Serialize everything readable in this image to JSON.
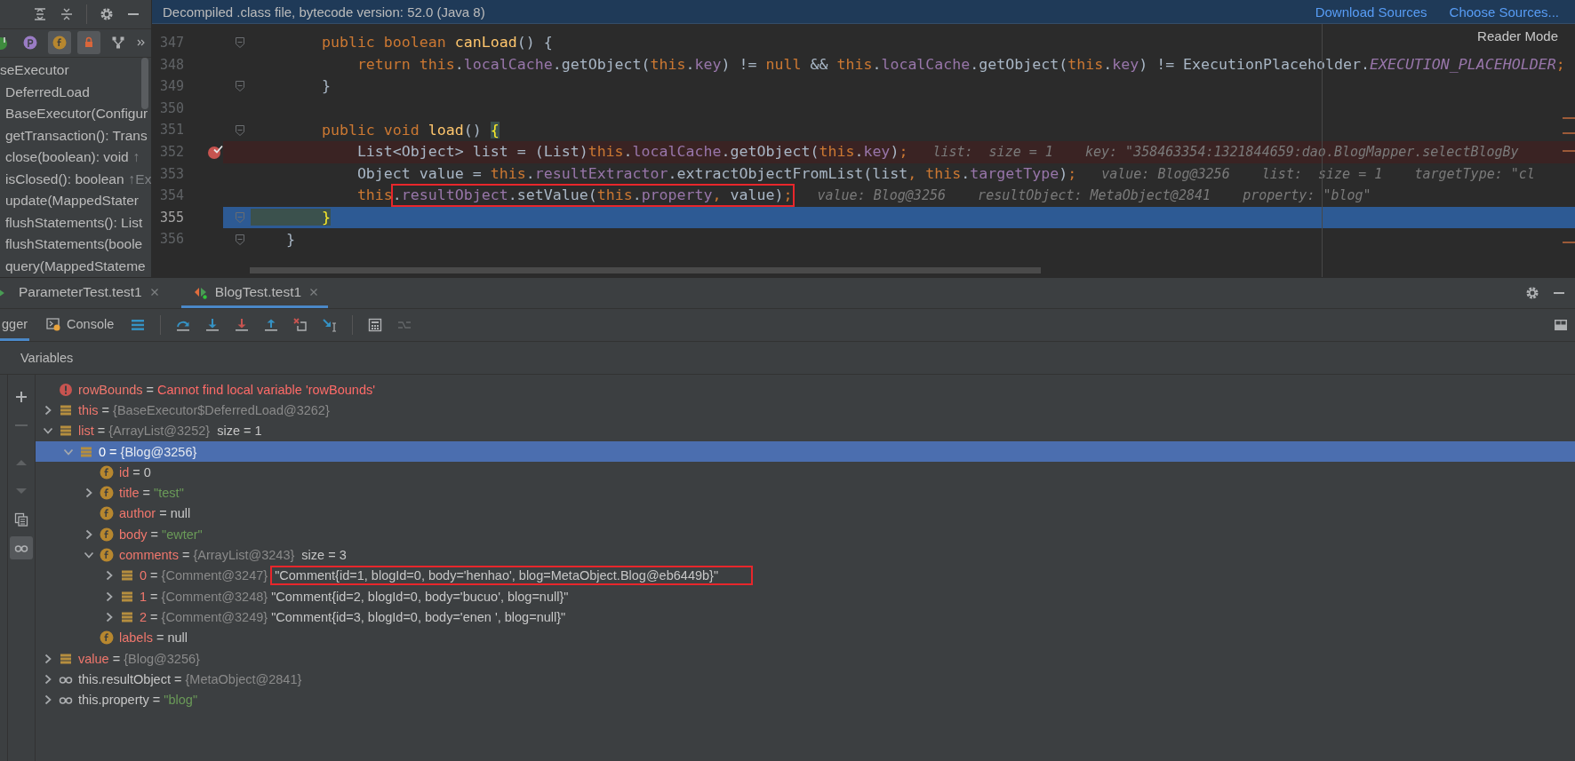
{
  "structure_panel": {
    "filters": [
      {
        "kind": "class",
        "on": false
      },
      {
        "kind": "property",
        "on": false
      },
      {
        "kind": "field",
        "on": true
      },
      {
        "kind": "lock",
        "on": true
      },
      {
        "kind": "inheritance",
        "on": false
      }
    ],
    "items": [
      {
        "text": "seExecutor",
        "children": [
          {
            "text": "DeferredLoad"
          },
          {
            "text": "BaseExecutor(Configur"
          },
          {
            "text": "getTransaction(): Trans"
          },
          {
            "text": "close(boolean): void",
            "suffix": "↑"
          },
          {
            "text": "isClosed(): boolean",
            "suffix": "↑Ex"
          },
          {
            "text": "update(MappedStater"
          },
          {
            "text": "flushStatements(): List"
          },
          {
            "text": "flushStatements(boole"
          },
          {
            "text": "query(MappedStateme"
          }
        ]
      }
    ]
  },
  "editor": {
    "banner": {
      "text": "Decompiled .class file, bytecode version: 52.0 (Java 8)",
      "links": [
        "Download Sources",
        "Choose Sources..."
      ]
    },
    "reader_mode": "Reader Mode",
    "lines": [
      {
        "number": "347",
        "kind": "normal",
        "fold": true,
        "tokens": [
          {
            "kind": "kw",
            "text": "        public boolean "
          },
          {
            "kind": "decl",
            "text": "canLoad"
          },
          {
            "kind": "plain",
            "text": "() {"
          }
        ]
      },
      {
        "number": "348",
        "kind": "normal",
        "fold": false,
        "tokens": [
          {
            "kind": "kw",
            "text": "            return this"
          },
          {
            "kind": "plain",
            "text": "."
          },
          {
            "kind": "fld",
            "text": "localCache"
          },
          {
            "kind": "plain",
            "text": ".getObject("
          },
          {
            "kind": "kw",
            "text": "this"
          },
          {
            "kind": "plain",
            "text": "."
          },
          {
            "kind": "fld",
            "text": "key"
          },
          {
            "kind": "plain",
            "text": ") != "
          },
          {
            "kind": "kw",
            "text": "null"
          },
          {
            "kind": "plain",
            "text": " && "
          },
          {
            "kind": "kw",
            "text": "this"
          },
          {
            "kind": "plain",
            "text": "."
          },
          {
            "kind": "fld",
            "text": "localCache"
          },
          {
            "kind": "plain",
            "text": ".getObject("
          },
          {
            "kind": "kw",
            "text": "this"
          },
          {
            "kind": "plain",
            "text": "."
          },
          {
            "kind": "fld",
            "text": "key"
          },
          {
            "kind": "plain",
            "text": ") != ExecutionPlaceholder."
          },
          {
            "kind": "const",
            "text": "EXECUTION_PLACEHOLDER"
          },
          {
            "kind": "kw",
            "text": ";"
          }
        ]
      },
      {
        "number": "349",
        "kind": "normal",
        "fold": true,
        "tokens": [
          {
            "kind": "plain",
            "text": "        }"
          }
        ]
      },
      {
        "number": "350",
        "kind": "normal",
        "fold": false
      },
      {
        "number": "351",
        "kind": "normal",
        "fold": true,
        "tokens": [
          {
            "kind": "kw",
            "text": "        public void "
          },
          {
            "kind": "decl",
            "text": "load"
          },
          {
            "kind": "plain",
            "text": "() "
          },
          {
            "kind": "brace",
            "text": "{"
          }
        ]
      },
      {
        "number": "352",
        "kind": "breakpoint",
        "fold": false,
        "tokens": [
          {
            "kind": "plain",
            "text": "            List<Object> list = (List)"
          },
          {
            "kind": "kw",
            "text": "this"
          },
          {
            "kind": "plain",
            "text": "."
          },
          {
            "kind": "fld",
            "text": "localCache"
          },
          {
            "kind": "plain",
            "text": ".getObject("
          },
          {
            "kind": "kw",
            "text": "this"
          },
          {
            "kind": "plain",
            "text": "."
          },
          {
            "kind": "fld",
            "text": "key"
          },
          {
            "kind": "plain",
            "text": ")"
          },
          {
            "kind": "kw",
            "text": ";"
          }
        ],
        "hints": "list:  size = 1    key: \"358463354:1321844659:dao.BlogMapper.selectBlogBy"
      },
      {
        "number": "353",
        "kind": "normal",
        "fold": false,
        "tokens": [
          {
            "kind": "plain",
            "text": "            Object value = "
          },
          {
            "kind": "kw",
            "text": "this"
          },
          {
            "kind": "plain",
            "text": "."
          },
          {
            "kind": "fld",
            "text": "resultExtractor"
          },
          {
            "kind": "plain",
            "text": ".extractObjectFromList(list"
          },
          {
            "kind": "kw",
            "text": ", this"
          },
          {
            "kind": "plain",
            "text": "."
          },
          {
            "kind": "fld",
            "text": "targetType"
          },
          {
            "kind": "plain",
            "text": ")"
          },
          {
            "kind": "kw",
            "text": ";"
          }
        ],
        "hints": "value: Blog@3256    list:  size = 1    targetType: \"cl"
      },
      {
        "number": "354",
        "kind": "normal",
        "fold": false,
        "tokens": [
          {
            "kind": "kw",
            "text": "            this"
          }
        ],
        "framed": [
          {
            "kind": "plain",
            "text": "."
          },
          {
            "kind": "fld",
            "text": "resultObject"
          },
          {
            "kind": "plain",
            "text": ".setValue("
          },
          {
            "kind": "kw",
            "text": "this"
          },
          {
            "kind": "plain",
            "text": "."
          },
          {
            "kind": "fld",
            "text": "property"
          },
          {
            "kind": "kw",
            "text": ","
          },
          {
            "kind": "plain",
            "text": " value)"
          },
          {
            "kind": "kw",
            "text": ";"
          }
        ],
        "hints": "value: Blog@3256    resultObject: MetaObject@2841    property: \"blog\""
      },
      {
        "number": "355",
        "kind": "execution",
        "fold": true,
        "tokens": [
          {
            "kind": "brace",
            "text": "        }"
          }
        ]
      },
      {
        "number": "356",
        "kind": "normal",
        "fold": true,
        "tokens": [
          {
            "kind": "plain",
            "text": "    }"
          }
        ]
      }
    ]
  },
  "debugger": {
    "run_tabs": [
      {
        "label": "ParameterTest.test1",
        "selected": false
      },
      {
        "label": "BlogTest.test1",
        "selected": true
      }
    ],
    "tool_tabs": [
      {
        "kind": "debugger",
        "label": "gger",
        "selected": true
      },
      {
        "kind": "console",
        "label": "Console",
        "selected": false
      }
    ],
    "actions": [
      {
        "kind": "frames-menu",
        "disabled": false
      },
      {
        "kind": "step-over",
        "disabled": false
      },
      {
        "kind": "step-into",
        "disabled": false
      },
      {
        "kind": "force-step-into",
        "disabled": false
      },
      {
        "kind": "step-out",
        "disabled": false
      },
      {
        "kind": "drop-frame",
        "disabled": false
      },
      {
        "kind": "run-to-cursor",
        "disabled": false
      },
      {
        "kind": "evaluate",
        "disabled": false
      },
      {
        "kind": "trace",
        "disabled": true
      }
    ],
    "variables_title": "Variables",
    "side_actions": [
      {
        "kind": "add",
        "disabled": false,
        "on": false
      },
      {
        "kind": "remove",
        "disabled": true,
        "on": false
      },
      {
        "kind": "up",
        "disabled": true,
        "on": false
      },
      {
        "kind": "down",
        "disabled": true,
        "on": false
      },
      {
        "kind": "copy",
        "disabled": false,
        "on": false
      },
      {
        "kind": "watches",
        "disabled": false,
        "on": true
      }
    ],
    "variables": [
      {
        "kind": "error",
        "selected": false,
        "name": "rowBounds",
        "value": [
          {
            "kind": "plain",
            "text": " = "
          },
          {
            "kind": "err",
            "text": "Cannot find local variable 'rowBounds'"
          }
        ]
      },
      {
        "kind": "object",
        "expandable": true,
        "expanded": false,
        "selected": false,
        "name": "this",
        "value": [
          {
            "kind": "plain",
            "text": " = "
          },
          {
            "kind": "ref",
            "text": "{BaseExecutor$DeferredLoad@3262}"
          }
        ]
      },
      {
        "kind": "object",
        "expandable": true,
        "expanded": true,
        "selected": false,
        "name": "list",
        "value": [
          {
            "kind": "plain",
            "text": " = "
          },
          {
            "kind": "ref",
            "text": "{ArrayList@3252}"
          },
          {
            "kind": "plain",
            "text": "  size = 1"
          }
        ],
        "children": [
          {
            "kind": "object",
            "expandable": true,
            "expanded": true,
            "selected": true,
            "name": "0",
            "value": [
              {
                "kind": "plain",
                "text": " = "
              },
              {
                "kind": "ref",
                "text": "{Blog@3256}"
              }
            ],
            "children": [
              {
                "kind": "field",
                "selected": false,
                "name": "id",
                "value": [
                  {
                    "kind": "plain",
                    "text": " = 0"
                  }
                ]
              },
              {
                "kind": "field",
                "expandable": true,
                "expanded": false,
                "selected": false,
                "name": "title",
                "value": [
                  {
                    "kind": "plain",
                    "text": " = "
                  },
                  {
                    "kind": "str",
                    "text": "\"test\""
                  }
                ]
              },
              {
                "kind": "field",
                "selected": false,
                "name": "author",
                "value": [
                  {
                    "kind": "plain",
                    "text": " = null"
                  }
                ]
              },
              {
                "kind": "field",
                "expandable": true,
                "expanded": false,
                "selected": false,
                "name": "body",
                "value": [
                  {
                    "kind": "plain",
                    "text": " = "
                  },
                  {
                    "kind": "str",
                    "text": "\"ewter\""
                  }
                ]
              },
              {
                "kind": "field",
                "expandable": true,
                "expanded": true,
                "selected": false,
                "name": "comments",
                "value": [
                  {
                    "kind": "plain",
                    "text": " = "
                  },
                  {
                    "kind": "ref",
                    "text": "{ArrayList@3243}"
                  },
                  {
                    "kind": "plain",
                    "text": "  size = 3"
                  }
                ],
                "children": [
                  {
                    "kind": "object",
                    "expandable": true,
                    "expanded": false,
                    "selected": false,
                    "name": "0",
                    "value": [
                      {
                        "kind": "plain",
                        "text": " = "
                      },
                      {
                        "kind": "ref",
                        "text": "{Comment@3247}"
                      }
                    ],
                    "framed": [
                      {
                        "kind": "plain",
                        "text": "\"Comment{id=1, blogId=0, body='henhao', blog=MetaObject.Blog@eb6449b}\""
                      }
                    ]
                  },
                  {
                    "kind": "object",
                    "expandable": true,
                    "expanded": false,
                    "selected": false,
                    "name": "1",
                    "value": [
                      {
                        "kind": "plain",
                        "text": " = "
                      },
                      {
                        "kind": "ref",
                        "text": "{Comment@3248}"
                      },
                      {
                        "kind": "plain",
                        "text": " \"Comment{id=2, blogId=0, body='bucuo', blog=null}\""
                      }
                    ]
                  },
                  {
                    "kind": "object",
                    "expandable": true,
                    "expanded": false,
                    "selected": false,
                    "name": "2",
                    "value": [
                      {
                        "kind": "plain",
                        "text": " = "
                      },
                      {
                        "kind": "ref",
                        "text": "{Comment@3249}"
                      },
                      {
                        "kind": "plain",
                        "text": " \"Comment{id=3, blogId=0, body='enen ', blog=null}\""
                      }
                    ]
                  }
                ]
              },
              {
                "kind": "field",
                "selected": false,
                "name": "labels",
                "value": [
                  {
                    "kind": "plain",
                    "text": " = null"
                  }
                ]
              }
            ]
          }
        ]
      },
      {
        "kind": "object",
        "expandable": true,
        "expanded": false,
        "selected": false,
        "name": "value",
        "value": [
          {
            "kind": "plain",
            "text": " = "
          },
          {
            "kind": "ref",
            "text": "{Blog@3256}"
          }
        ]
      },
      {
        "kind": "watch",
        "expandable": true,
        "expanded": false,
        "selected": false,
        "name": "this.resultObject",
        "value": [
          {
            "kind": "plain",
            "text": " = "
          },
          {
            "kind": "ref",
            "text": "{MetaObject@2841}"
          }
        ]
      },
      {
        "kind": "watch",
        "expandable": true,
        "expanded": false,
        "selected": false,
        "name": "this.property",
        "value": [
          {
            "kind": "plain",
            "text": " = "
          },
          {
            "kind": "str",
            "text": "\"blog\""
          }
        ]
      }
    ]
  }
}
